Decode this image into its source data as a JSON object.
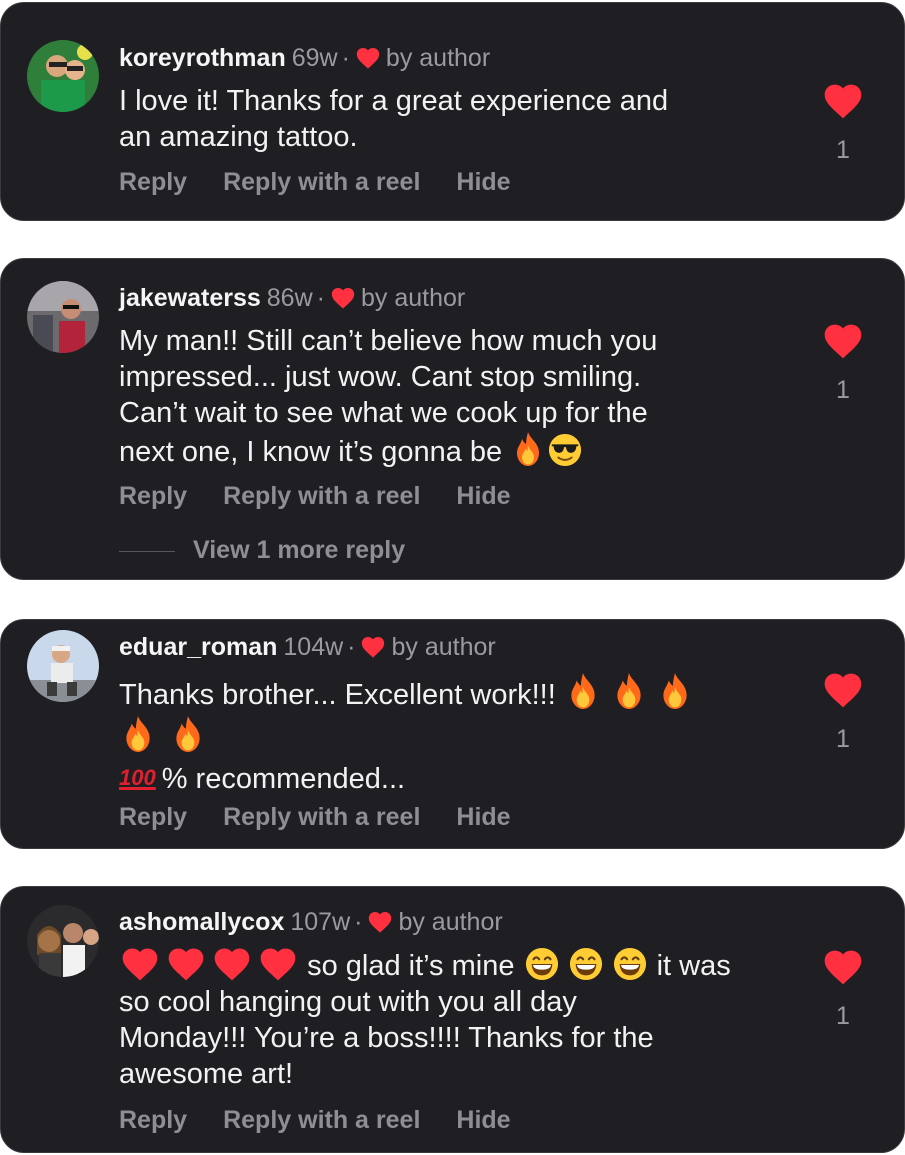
{
  "comments": [
    {
      "username": "koreyrothman",
      "time": "69w",
      "dot": "·",
      "by_author": "by author",
      "lines": [
        "I love it!  Thanks for a great experience and",
        "an amazing tattoo."
      ],
      "actions": {
        "reply": "Reply",
        "reply_reel": "Reply with a reel",
        "hide": "Hide"
      },
      "like_count": "1"
    },
    {
      "username": "jakewaterss",
      "time": "86w",
      "dot": "·",
      "by_author": "by author",
      "lines": [
        "My man!! Still can’t believe how much you",
        "impressed... just wow. Cant stop smiling.",
        "Can’t wait to see what we cook up for the",
        "next one, I know it’s gonna be"
      ],
      "actions": {
        "reply": "Reply",
        "reply_reel": "Reply with a reel",
        "hide": "Hide"
      },
      "view_more": "View 1 more reply",
      "like_count": "1"
    },
    {
      "username": "eduar_roman",
      "time": "104w",
      "dot": "·",
      "by_author": "by author",
      "lines": [
        "Thanks brother... Excellent work!!!",
        "",
        "% recommended..."
      ],
      "actions": {
        "reply": "Reply",
        "reply_reel": "Reply with a reel",
        "hide": "Hide"
      },
      "like_count": "1"
    },
    {
      "username": "ashomallycox",
      "time": "107w",
      "dot": "·",
      "by_author": "by author",
      "lines": [
        "so glad it’s mine",
        "it was",
        "so cool hanging out with you all day",
        "Monday!!! You’re a boss!!!! Thanks for the",
        "awesome art!"
      ],
      "actions": {
        "reply": "Reply",
        "reply_reel": "Reply with a reel",
        "hide": "Hide"
      },
      "like_count": "1"
    }
  ],
  "icons": {
    "liked": "heart-icon",
    "fire": "fire-emoji",
    "sunglasses": "sunglasses-emoji",
    "hundred": "hundred-points-emoji",
    "grin": "grinning-emoji",
    "red_heart": "red-heart-emoji"
  },
  "colors": {
    "card_bg": "#1f1f23",
    "heart": "#ff3040",
    "muted": "#8e8e93",
    "text": "#f2f2f2"
  },
  "emoji_labels": {
    "hundred": "100"
  }
}
